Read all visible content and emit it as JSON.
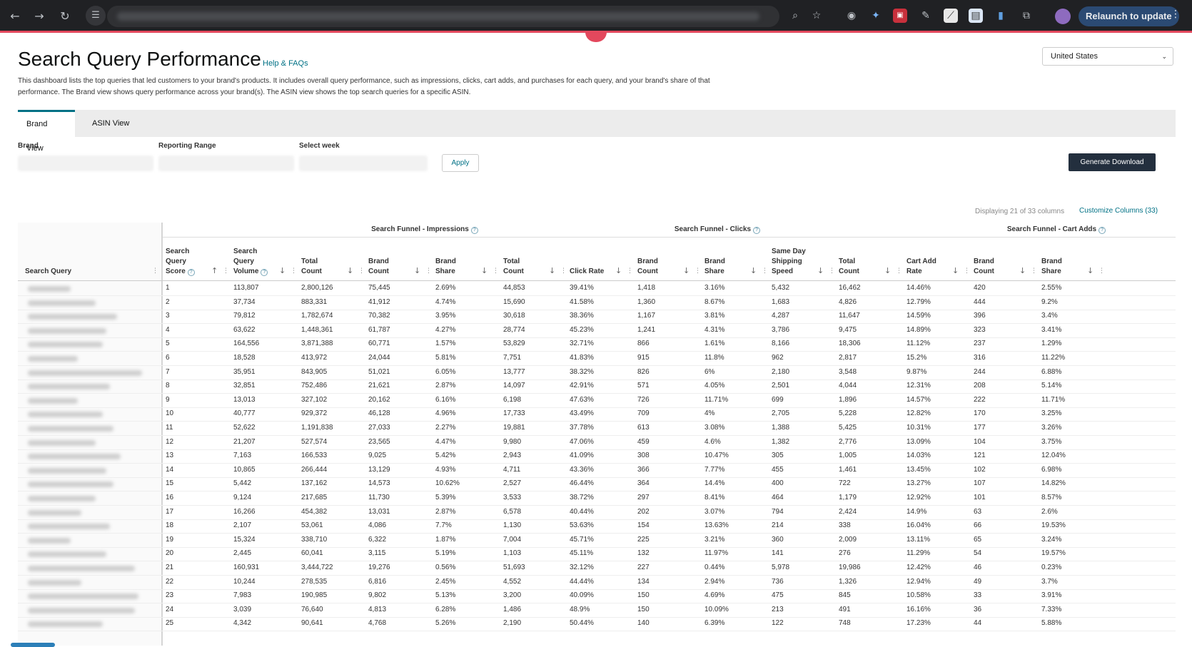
{
  "browser": {
    "relaunch_label": "Relaunch to update",
    "icons": [
      "back-icon",
      "forward-icon",
      "reload-icon",
      "tune-icon",
      "zoom-icon",
      "star-icon",
      "camera-icon",
      "extension-icon",
      "puzzle-icon",
      "profile-avatar",
      "more-vert-icon"
    ]
  },
  "header": {
    "title": "Search Query Performance",
    "help_link": "Help & FAQs",
    "description": "This dashboard lists the top queries that led customers to your brand's products. It includes overall query performance, such as impressions, clicks, cart adds, and purchases for each query, and your brand's share of that performance. The Brand view shows query performance across your brand(s). The ASIN view shows the top search queries for a specific ASIN.",
    "country": "United States"
  },
  "tabs": [
    {
      "label": "Brand View",
      "active": true
    },
    {
      "label": "ASIN View",
      "active": false
    }
  ],
  "filters": {
    "brand_label": "Brand",
    "range_label": "Reporting Range",
    "week_label": "Select week",
    "apply_label": "Apply",
    "download_label": "Generate Download"
  },
  "table_meta": {
    "displaying": "Displaying 21 of 33 columns",
    "customize": "Customize Columns (33)"
  },
  "groups": {
    "impressions": "Search Funnel - Impressions",
    "clicks": "Search Funnel - Clicks",
    "cart_adds": "Search Funnel - Cart Adds"
  },
  "columns": [
    {
      "l1": "Search Query",
      "l2": "",
      "l3": "",
      "info": true
    },
    {
      "l1": "Search",
      "l2": "Query",
      "l3": "Score",
      "info": true,
      "sort": "↑"
    },
    {
      "l1": "Search",
      "l2": "Query",
      "l3": "Volume",
      "info": true,
      "sort": "↓"
    },
    {
      "l1": "",
      "l2": "Total",
      "l3": "Count",
      "sort": "↓"
    },
    {
      "l1": "",
      "l2": "Brand",
      "l3": "Count",
      "sort": "↓"
    },
    {
      "l1": "",
      "l2": "Brand",
      "l3": "Share",
      "sort": "↓"
    },
    {
      "l1": "",
      "l2": "Total",
      "l3": "Count",
      "sort": "↓"
    },
    {
      "l1": "",
      "l2": "",
      "l3": "Click Rate",
      "sort": "↓"
    },
    {
      "l1": "",
      "l2": "Brand",
      "l3": "Count",
      "sort": "↓"
    },
    {
      "l1": "",
      "l2": "Brand",
      "l3": "Share",
      "sort": "↓"
    },
    {
      "l1": "Same Day",
      "l2": "Shipping",
      "l3": "Speed",
      "sort": "↓"
    },
    {
      "l1": "",
      "l2": "Total",
      "l3": "Count",
      "sort": "↓"
    },
    {
      "l1": "",
      "l2": "Cart Add",
      "l3": "Rate",
      "sort": "↓"
    },
    {
      "l1": "",
      "l2": "Brand",
      "l3": "Count",
      "sort": "↓"
    },
    {
      "l1": "",
      "l2": "Brand",
      "l3": "Share",
      "sort": "↓"
    }
  ],
  "rows": [
    [
      "1",
      "113,807",
      "2,800,126",
      "75,445",
      "2.69%",
      "44,853",
      "39.41%",
      "1,418",
      "3.16%",
      "5,432",
      "16,462",
      "14.46%",
      "420",
      "2.55%"
    ],
    [
      "2",
      "37,734",
      "883,331",
      "41,912",
      "4.74%",
      "15,690",
      "41.58%",
      "1,360",
      "8.67%",
      "1,683",
      "4,826",
      "12.79%",
      "444",
      "9.2%"
    ],
    [
      "3",
      "79,812",
      "1,782,674",
      "70,382",
      "3.95%",
      "30,618",
      "38.36%",
      "1,167",
      "3.81%",
      "4,287",
      "11,647",
      "14.59%",
      "396",
      "3.4%"
    ],
    [
      "4",
      "63,622",
      "1,448,361",
      "61,787",
      "4.27%",
      "28,774",
      "45.23%",
      "1,241",
      "4.31%",
      "3,786",
      "9,475",
      "14.89%",
      "323",
      "3.41%"
    ],
    [
      "5",
      "164,556",
      "3,871,388",
      "60,771",
      "1.57%",
      "53,829",
      "32.71%",
      "866",
      "1.61%",
      "8,166",
      "18,306",
      "11.12%",
      "237",
      "1.29%"
    ],
    [
      "6",
      "18,528",
      "413,972",
      "24,044",
      "5.81%",
      "7,751",
      "41.83%",
      "915",
      "11.8%",
      "962",
      "2,817",
      "15.2%",
      "316",
      "11.22%"
    ],
    [
      "7",
      "35,951",
      "843,905",
      "51,021",
      "6.05%",
      "13,777",
      "38.32%",
      "826",
      "6%",
      "2,180",
      "3,548",
      "9.87%",
      "244",
      "6.88%"
    ],
    [
      "8",
      "32,851",
      "752,486",
      "21,621",
      "2.87%",
      "14,097",
      "42.91%",
      "571",
      "4.05%",
      "2,501",
      "4,044",
      "12.31%",
      "208",
      "5.14%"
    ],
    [
      "9",
      "13,013",
      "327,102",
      "20,162",
      "6.16%",
      "6,198",
      "47.63%",
      "726",
      "11.71%",
      "699",
      "1,896",
      "14.57%",
      "222",
      "11.71%"
    ],
    [
      "10",
      "40,777",
      "929,372",
      "46,128",
      "4.96%",
      "17,733",
      "43.49%",
      "709",
      "4%",
      "2,705",
      "5,228",
      "12.82%",
      "170",
      "3.25%"
    ],
    [
      "11",
      "52,622",
      "1,191,838",
      "27,033",
      "2.27%",
      "19,881",
      "37.78%",
      "613",
      "3.08%",
      "1,388",
      "5,425",
      "10.31%",
      "177",
      "3.26%"
    ],
    [
      "12",
      "21,207",
      "527,574",
      "23,565",
      "4.47%",
      "9,980",
      "47.06%",
      "459",
      "4.6%",
      "1,382",
      "2,776",
      "13.09%",
      "104",
      "3.75%"
    ],
    [
      "13",
      "7,163",
      "166,533",
      "9,025",
      "5.42%",
      "2,943",
      "41.09%",
      "308",
      "10.47%",
      "305",
      "1,005",
      "14.03%",
      "121",
      "12.04%"
    ],
    [
      "14",
      "10,865",
      "266,444",
      "13,129",
      "4.93%",
      "4,711",
      "43.36%",
      "366",
      "7.77%",
      "455",
      "1,461",
      "13.45%",
      "102",
      "6.98%"
    ],
    [
      "15",
      "5,442",
      "137,162",
      "14,573",
      "10.62%",
      "2,527",
      "46.44%",
      "364",
      "14.4%",
      "400",
      "722",
      "13.27%",
      "107",
      "14.82%"
    ],
    [
      "16",
      "9,124",
      "217,685",
      "11,730",
      "5.39%",
      "3,533",
      "38.72%",
      "297",
      "8.41%",
      "464",
      "1,179",
      "12.92%",
      "101",
      "8.57%"
    ],
    [
      "17",
      "16,266",
      "454,382",
      "13,031",
      "2.87%",
      "6,578",
      "40.44%",
      "202",
      "3.07%",
      "794",
      "2,424",
      "14.9%",
      "63",
      "2.6%"
    ],
    [
      "18",
      "2,107",
      "53,061",
      "4,086",
      "7.7%",
      "1,130",
      "53.63%",
      "154",
      "13.63%",
      "214",
      "338",
      "16.04%",
      "66",
      "19.53%"
    ],
    [
      "19",
      "15,324",
      "338,710",
      "6,322",
      "1.87%",
      "7,004",
      "45.71%",
      "225",
      "3.21%",
      "360",
      "2,009",
      "13.11%",
      "65",
      "3.24%"
    ],
    [
      "20",
      "2,445",
      "60,041",
      "3,115",
      "5.19%",
      "1,103",
      "45.11%",
      "132",
      "11.97%",
      "141",
      "276",
      "11.29%",
      "54",
      "19.57%"
    ],
    [
      "21",
      "160,931",
      "3,444,722",
      "19,276",
      "0.56%",
      "51,693",
      "32.12%",
      "227",
      "0.44%",
      "5,978",
      "19,986",
      "12.42%",
      "46",
      "0.23%"
    ],
    [
      "22",
      "10,244",
      "278,535",
      "6,816",
      "2.45%",
      "4,552",
      "44.44%",
      "134",
      "2.94%",
      "736",
      "1,326",
      "12.94%",
      "49",
      "3.7%"
    ],
    [
      "23",
      "7,983",
      "190,985",
      "9,802",
      "5.13%",
      "3,200",
      "40.09%",
      "150",
      "4.69%",
      "475",
      "845",
      "10.58%",
      "33",
      "3.91%"
    ],
    [
      "24",
      "3,039",
      "76,640",
      "4,813",
      "6.28%",
      "1,486",
      "48.9%",
      "150",
      "10.09%",
      "213",
      "491",
      "16.16%",
      "36",
      "7.33%"
    ],
    [
      "25",
      "4,342",
      "90,641",
      "4,768",
      "5.26%",
      "2,190",
      "50.44%",
      "140",
      "6.39%",
      "122",
      "748",
      "17.23%",
      "44",
      "5.88%"
    ]
  ]
}
